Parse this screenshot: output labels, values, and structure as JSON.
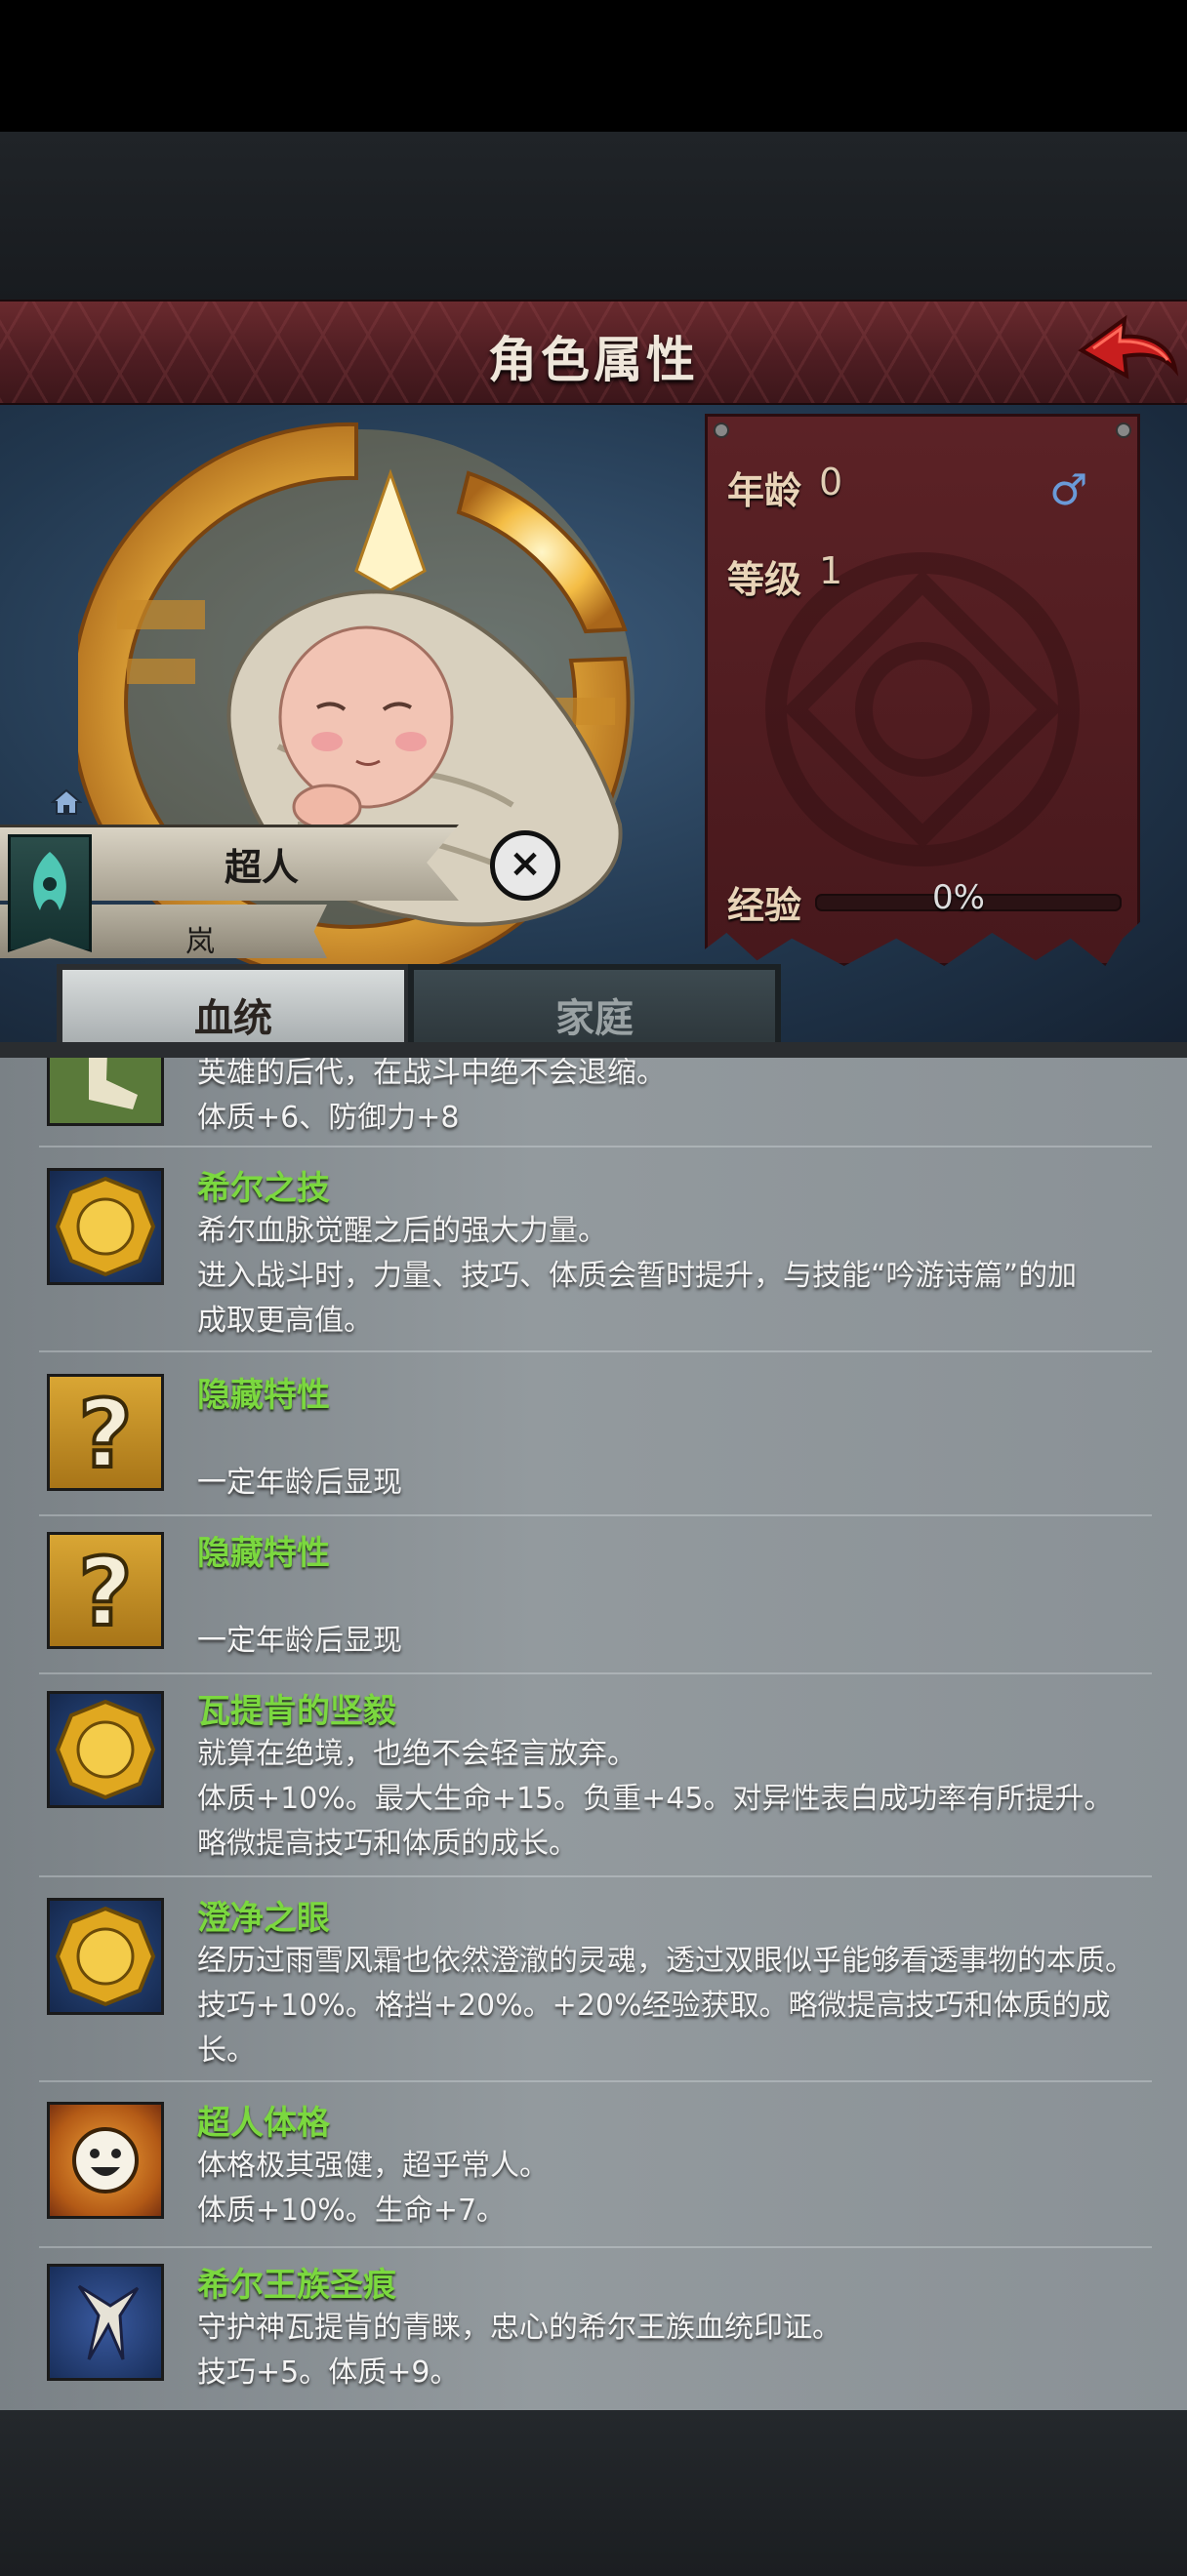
{
  "header": {
    "title": "角色属性"
  },
  "character": {
    "age_label": "年龄",
    "age_value": "0",
    "level_label": "等级",
    "level_value": "1",
    "gender_symbol": "♂",
    "exp_label": "经验",
    "exp_percent": "0%",
    "exp_fraction": 0,
    "name": "超人",
    "sub_label": "岚"
  },
  "tabs": [
    {
      "label": "血统",
      "active": true
    },
    {
      "label": "家庭",
      "active": false
    }
  ],
  "traits": [
    {
      "icon": "leg-icon",
      "name": "",
      "lines": [
        "英雄的后代，在战斗中绝不会退缩。",
        "体质+6、防御力+8"
      ]
    },
    {
      "icon": "gold-coin-icon",
      "name": "希尔之技",
      "lines": [
        "希尔血脉觉醒之后的强大力量。",
        "进入战斗时，力量、技巧、体质会暂时提升，与技能“吟游诗篇”的加",
        "成取更高值。"
      ]
    },
    {
      "icon": "question-icon",
      "name": "隐藏特性",
      "lines": [
        "",
        "一定年龄后显现"
      ]
    },
    {
      "icon": "question-icon",
      "name": "隐藏特性",
      "lines": [
        "",
        "一定年龄后显现"
      ]
    },
    {
      "icon": "gold-coin-icon",
      "name": "瓦提肯的坚毅",
      "lines": [
        "就算在绝境，也绝不会轻言放弃。",
        "体质+10%。最大生命+15。负重+45。对异性表白成功率有所提升。",
        "略微提高技巧和体质的成长。"
      ]
    },
    {
      "icon": "gold-coin-icon",
      "name": "澄净之眼",
      "lines": [
        "经历过雨雪风霜也依然澄澈的灵魂，透过双眼似乎能够看透事物的本质。",
        "技巧+10%。格挡+20%。+20%经验获取。略微提高技巧和体质的成",
        "长。"
      ]
    },
    {
      "icon": "smiley-sun-icon",
      "name": "超人体格",
      "lines": [
        "体格极其强健，超乎常人。",
        "体质+10%。生命+7。"
      ]
    },
    {
      "icon": "claw-crest-icon",
      "name": "希尔王族圣痕",
      "lines": [
        "守护神瓦提肯的青睐，忠心的希尔王族血统印证。",
        "技巧+5。体质+9。"
      ]
    }
  ],
  "colors": {
    "trait_name": "#7bd83f",
    "title_bar": "#5a2226",
    "panel": "#52191d"
  }
}
